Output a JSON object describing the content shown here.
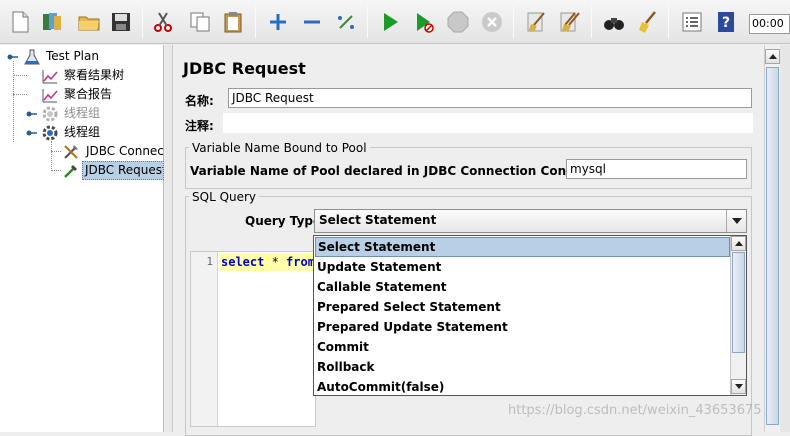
{
  "toolbar": {
    "timer_text": "00:00",
    "buttons": [
      {
        "name": "new",
        "icon": "new-file-icon"
      },
      {
        "name": "templates",
        "icon": "templates-icon"
      },
      {
        "name": "open",
        "icon": "open-folder-icon"
      },
      {
        "name": "save",
        "icon": "save-disk-icon"
      },
      {
        "name": "cut",
        "icon": "scissors-icon"
      },
      {
        "name": "copy",
        "icon": "copy-icon"
      },
      {
        "name": "paste",
        "icon": "paste-clipboard-icon"
      },
      {
        "name": "expand",
        "icon": "plus-icon"
      },
      {
        "name": "collapse",
        "icon": "minus-icon"
      },
      {
        "name": "toggle",
        "icon": "toggle-wand-icon"
      },
      {
        "name": "start",
        "icon": "play-icon"
      },
      {
        "name": "start-no-pauses",
        "icon": "play-no-timer-icon"
      },
      {
        "name": "stop",
        "icon": "stop-icon"
      },
      {
        "name": "shutdown",
        "icon": "shutdown-icon"
      },
      {
        "name": "clear",
        "icon": "clear-broom-icon"
      },
      {
        "name": "clear-all",
        "icon": "clear-all-broom-icon"
      },
      {
        "name": "search",
        "icon": "binoculars-icon"
      },
      {
        "name": "reset-search",
        "icon": "broom-icon"
      },
      {
        "name": "function-helper",
        "icon": "list-icon"
      },
      {
        "name": "help",
        "icon": "help-book-icon"
      }
    ]
  },
  "tree": {
    "items": [
      {
        "label": "Test Plan"
      },
      {
        "label": "察看结果树"
      },
      {
        "label": "聚合报告"
      },
      {
        "label": "线程组"
      },
      {
        "label": "线程组"
      },
      {
        "label": "JDBC Connection Configuration"
      },
      {
        "label": "JDBC Request"
      }
    ]
  },
  "panel": {
    "title": "JDBC Request",
    "name_label": "名称:",
    "name_value": "JDBC Request",
    "comments_label": "注释:",
    "pool_group_title": "Variable Name Bound to Pool",
    "pool_label": "Variable Name of Pool declared in JDBC Connection Configuration:",
    "pool_value": "mysql",
    "sql_group_title": "SQL Query",
    "query_type_label": "Query Type:",
    "query_type_value": "Select Statement",
    "editor": {
      "line_number": "1",
      "code_keyword1": "select",
      "code_op": " * ",
      "code_keyword2": "from"
    }
  },
  "dropdown": {
    "options": [
      "Select Statement",
      "Update Statement",
      "Callable Statement",
      "Prepared Select Statement",
      "Prepared Update Statement",
      "Commit",
      "Rollback",
      "AutoCommit(false)"
    ],
    "selected_index": 0
  },
  "watermark": "https://blog.csdn.net/weixin_43653675"
}
